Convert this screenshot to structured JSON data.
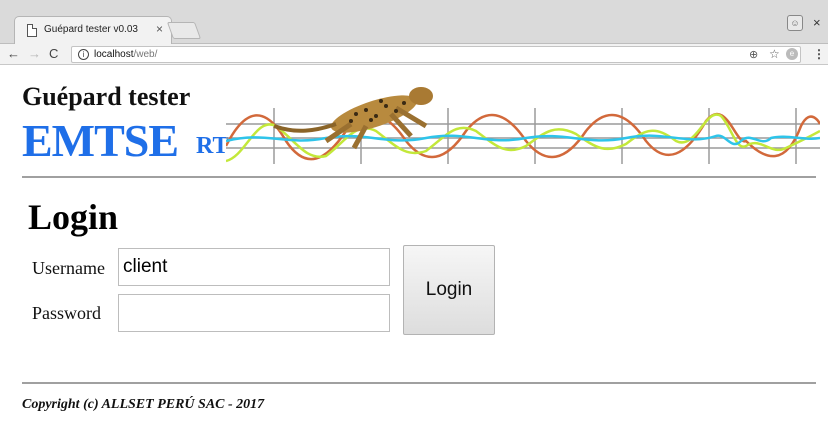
{
  "browser": {
    "tab_title": "Guépard tester v0.03",
    "tab_close": "×",
    "window_close": "×",
    "url_host": "localhost",
    "url_path": "/web/",
    "icons": {
      "back": "arrow-left-icon",
      "forward": "arrow-right-icon",
      "reload": "reload-icon",
      "info": "info-icon",
      "zoom": "zoom-icon",
      "star": "star-icon",
      "menu": "menu-dots-icon"
    }
  },
  "header": {
    "app_name": "Guépard tester",
    "brand": "EMTSE",
    "brand_suffix": "RT",
    "brand_color": "#1f6fe8"
  },
  "login": {
    "title": "Login",
    "username_label": "Username",
    "username_value": "client",
    "password_label": "Password",
    "password_value": "",
    "button_label": "Login"
  },
  "footer": {
    "copyright": "Copyright (c) ALLSET PERÚ SAC - 2017"
  }
}
